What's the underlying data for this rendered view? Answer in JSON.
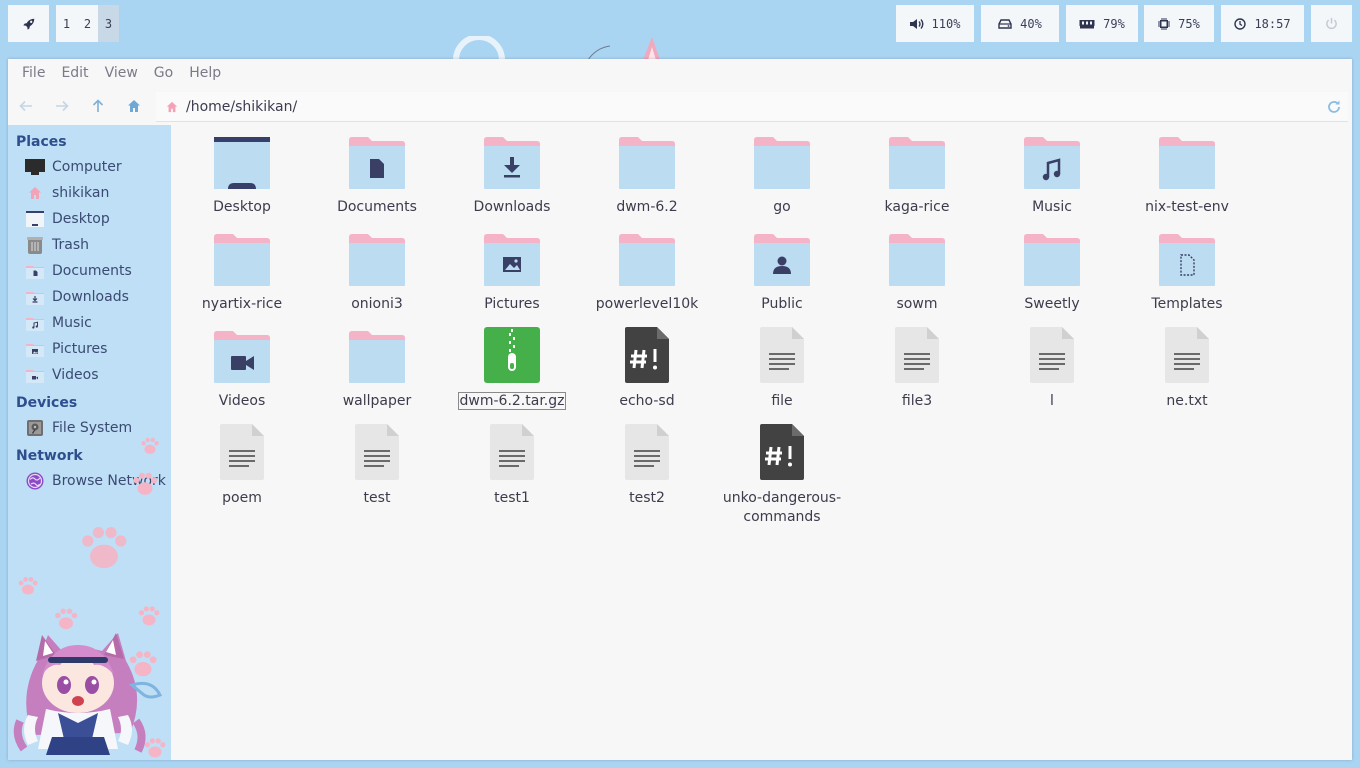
{
  "topbar": {
    "workspaces": [
      "1",
      "2",
      "3"
    ],
    "active_workspace": "3",
    "volume": "110%",
    "disk": "40%",
    "ram": "79%",
    "cpu": "75%",
    "clock": "18:57"
  },
  "menu": [
    "File",
    "Edit",
    "View",
    "Go",
    "Help"
  ],
  "location": "/home/shikikan/",
  "sidebar": {
    "places_header": "Places",
    "places": [
      {
        "label": "Computer",
        "icon": "monitor-icon"
      },
      {
        "label": "shikikan",
        "icon": "home-icon"
      },
      {
        "label": "Desktop",
        "icon": "desktop-icon"
      },
      {
        "label": "Trash",
        "icon": "trash-icon"
      },
      {
        "label": "Documents",
        "icon": "documents-folder-icon"
      },
      {
        "label": "Downloads",
        "icon": "downloads-folder-icon"
      },
      {
        "label": "Music",
        "icon": "music-folder-icon"
      },
      {
        "label": "Pictures",
        "icon": "pictures-folder-icon"
      },
      {
        "label": "Videos",
        "icon": "videos-folder-icon"
      }
    ],
    "devices_header": "Devices",
    "devices": [
      {
        "label": "File System",
        "icon": "drive-icon"
      }
    ],
    "network_header": "Network",
    "network": [
      {
        "label": "Browse Network",
        "icon": "network-icon"
      }
    ]
  },
  "files": [
    {
      "name": "Desktop",
      "kind": "desktop"
    },
    {
      "name": "Documents",
      "kind": "folder-doc"
    },
    {
      "name": "Downloads",
      "kind": "folder-down"
    },
    {
      "name": "dwm-6.2",
      "kind": "folder"
    },
    {
      "name": "go",
      "kind": "folder"
    },
    {
      "name": "kaga-rice",
      "kind": "folder"
    },
    {
      "name": "Music",
      "kind": "folder-music"
    },
    {
      "name": "nix-test-env",
      "kind": "folder"
    },
    {
      "name": "nyartix-rice",
      "kind": "folder"
    },
    {
      "name": "onioni3",
      "kind": "folder"
    },
    {
      "name": "Pictures",
      "kind": "folder-pic"
    },
    {
      "name": "powerlevel10k",
      "kind": "folder"
    },
    {
      "name": "Public",
      "kind": "folder-public"
    },
    {
      "name": "sowm",
      "kind": "folder"
    },
    {
      "name": "Sweetly",
      "kind": "folder"
    },
    {
      "name": "Templates",
      "kind": "folder-template"
    },
    {
      "name": "Videos",
      "kind": "folder-video"
    },
    {
      "name": "wallpaper",
      "kind": "folder"
    },
    {
      "name": "dwm-6.2.tar.gz",
      "kind": "archive",
      "selected": true
    },
    {
      "name": "echo-sd",
      "kind": "script"
    },
    {
      "name": "file",
      "kind": "text"
    },
    {
      "name": "file3",
      "kind": "text"
    },
    {
      "name": "l",
      "kind": "text"
    },
    {
      "name": "ne.txt",
      "kind": "text"
    },
    {
      "name": "poem",
      "kind": "text"
    },
    {
      "name": "test",
      "kind": "text"
    },
    {
      "name": "test1",
      "kind": "text"
    },
    {
      "name": "test2",
      "kind": "text"
    },
    {
      "name": "unko-dangerous-commands",
      "kind": "script"
    }
  ],
  "colors": {
    "folder_body": "#bcdcf2",
    "folder_tab": "#f4b3c6",
    "glyph": "#3a3f66",
    "archive": "#45b04a",
    "script": "#424242"
  }
}
